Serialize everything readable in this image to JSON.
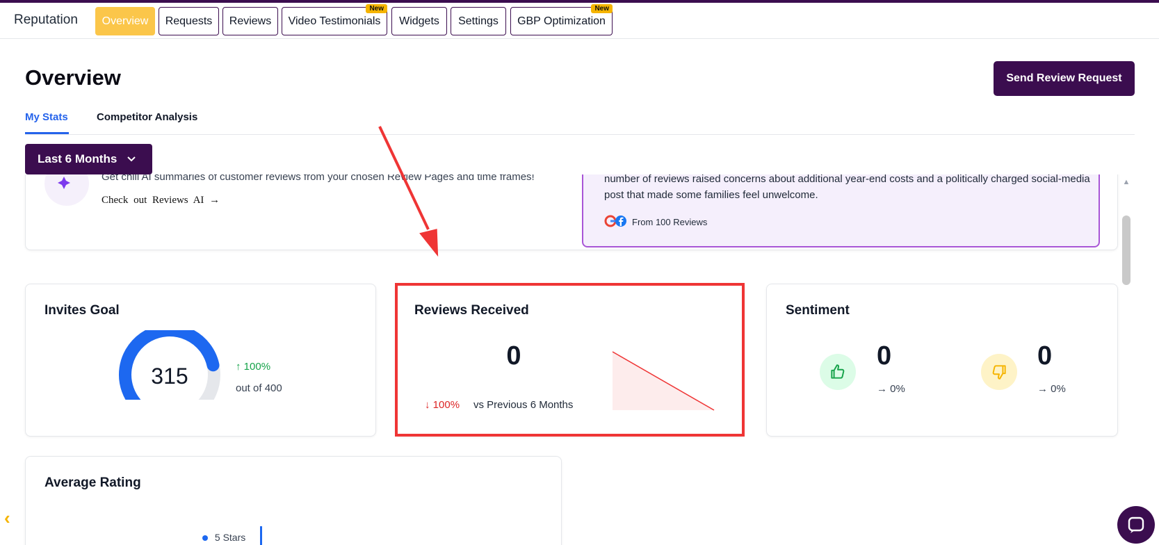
{
  "app": {
    "title": "Reputation"
  },
  "nav": {
    "tabs": [
      {
        "label": "Overview",
        "active": true
      },
      {
        "label": "Requests"
      },
      {
        "label": "Reviews"
      },
      {
        "label": "Video Testimonials",
        "badge": "New"
      },
      {
        "label": "Widgets"
      },
      {
        "label": "Settings"
      },
      {
        "label": "GBP Optimization",
        "badge": "New"
      }
    ]
  },
  "header": {
    "title": "Overview",
    "primary_button": "Send Review Request"
  },
  "subtabs": [
    {
      "label": "My Stats",
      "active": true
    },
    {
      "label": "Competitor Analysis"
    }
  ],
  "filter": {
    "label": "Last 6 Months"
  },
  "ai_banner": {
    "text": "Get chill AI summaries of customer reviews from your chosen Review Pages and time frames!",
    "link": "Check out Reviews AI",
    "summary_text": "number of reviews raised concerns about additional year-end costs and a politically charged social-media post that made some families feel unwelcome.",
    "source_text": "From 100 Reviews"
  },
  "invites_goal": {
    "title": "Invites Goal",
    "value": "315",
    "trend": "100%",
    "goal_text": "out of 400",
    "progress": 0.7875
  },
  "reviews_received": {
    "title": "Reviews Received",
    "value": "0",
    "trend": "100%",
    "comparison": "vs Previous 6 Months"
  },
  "sentiment": {
    "title": "Sentiment",
    "positive": {
      "value": "0",
      "change": "0%"
    },
    "negative": {
      "value": "0",
      "change": "0%"
    }
  },
  "average_rating": {
    "title": "Average Rating",
    "legend_first": "5 Stars"
  },
  "colors": {
    "brand": "#3b0d4f",
    "accent": "#fbc64a",
    "link": "#2563eb",
    "positive": "#16a34a",
    "negative": "#dc2626",
    "highlight": "#ef3535"
  }
}
